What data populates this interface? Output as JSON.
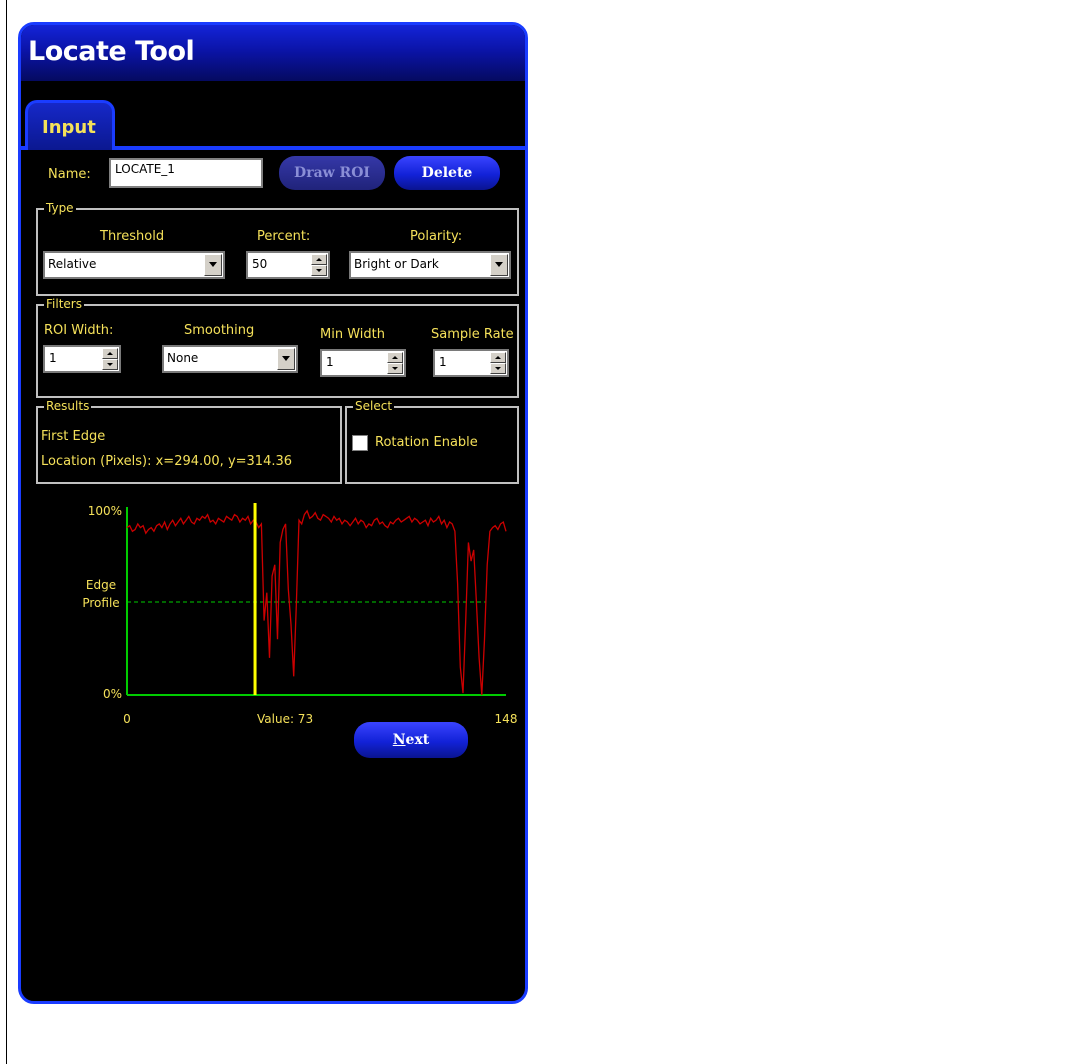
{
  "window": {
    "title": "Locate Tool"
  },
  "tabs": [
    {
      "label": "Input"
    }
  ],
  "name": {
    "label": "Name:",
    "value": "LOCATE_1"
  },
  "buttons": {
    "draw_roi": "Draw ROI",
    "delete": "Delete",
    "next_prefix": "N",
    "next_rest": "ext"
  },
  "type_group": {
    "title": "Type",
    "threshold": {
      "label": "Threshold",
      "value": "Relative"
    },
    "percent": {
      "label": "Percent:",
      "value": "50"
    },
    "polarity": {
      "label": "Polarity:",
      "value": "Bright or Dark"
    }
  },
  "filters_group": {
    "title": "Filters",
    "roi_width": {
      "label": "ROI Width:",
      "value": "1"
    },
    "smoothing": {
      "label": "Smoothing",
      "value": "None"
    },
    "min_width": {
      "label": "Min Width",
      "value": "1"
    },
    "sample_rate": {
      "label": "Sample Rate",
      "value": "1"
    }
  },
  "results_group": {
    "title": "Results",
    "line1": "First Edge",
    "line2": "Location (Pixels):  x=294.00, y=314.36"
  },
  "select_group": {
    "title": "Select",
    "rotation_label": "Rotation Enable",
    "rotation_checked": false
  },
  "colors": {
    "accent": "#1a3cff",
    "label": "#f5e15a",
    "profile_line": "#cc0000",
    "axis": "#00cc00",
    "marker": "#ffff00",
    "threshold_line": "#00cc00"
  },
  "chart_data": {
    "type": "line",
    "ylabel": "Edge Profile",
    "ytick_labels": [
      "100%",
      "0%"
    ],
    "xtick_labels": [
      "0",
      "148"
    ],
    "value_label": "Value:  73",
    "xlim": [
      0,
      148
    ],
    "ylim": [
      0,
      100
    ],
    "threshold": 50,
    "marker_x": 50,
    "series": [
      {
        "values": [
          90,
          91,
          88,
          89,
          92,
          90,
          91,
          87,
          89,
          90,
          88,
          91,
          92,
          90,
          93,
          89,
          92,
          94,
          91,
          93,
          95,
          92,
          94,
          96,
          93,
          92,
          95,
          94,
          96,
          95,
          97,
          93,
          94,
          92,
          95,
          94,
          93,
          96,
          95,
          94,
          97,
          96,
          93,
          95,
          94,
          96,
          92,
          94,
          93,
          90,
          92,
          40,
          55,
          20,
          64,
          70,
          30,
          82,
          89,
          92,
          57,
          38,
          10,
          48,
          94,
          92,
          97,
          99,
          95,
          96,
          98,
          95,
          94,
          97,
          96,
          95,
          93,
          96,
          94,
          95,
          92,
          94,
          93,
          91,
          93,
          95,
          92,
          94,
          93,
          90,
          92,
          91,
          94,
          95,
          92,
          93,
          91,
          90,
          93,
          92,
          94,
          95,
          93,
          94,
          95,
          96,
          93,
          95,
          94,
          92,
          93,
          94,
          91,
          95,
          93,
          94,
          96,
          92,
          94,
          90,
          93,
          92,
          88,
          60,
          15,
          1,
          40,
          82,
          72,
          78,
          50,
          20,
          0,
          30,
          70,
          88,
          90,
          91,
          89,
          92,
          93,
          88
        ]
      }
    ]
  }
}
